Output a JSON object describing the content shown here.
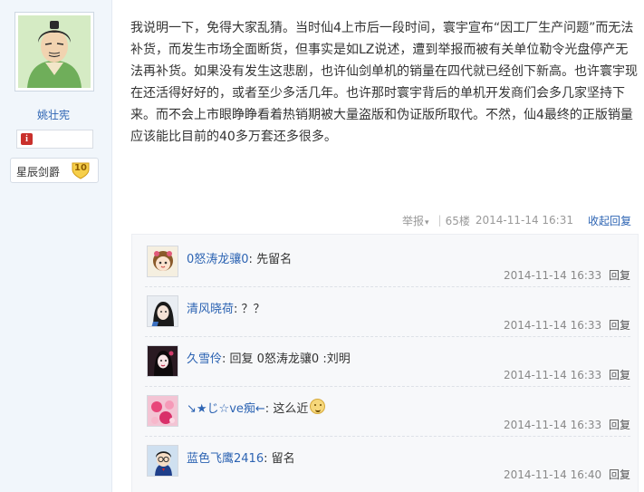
{
  "author": {
    "name": "姚壮宪",
    "avatar_icon": "swordsman-avatar-icon",
    "info_icon": "warning-icon",
    "level_name": "星辰剑爵",
    "level_number": "10"
  },
  "post": {
    "content": "我说明一下，免得大家乱猜。当时仙4上市后一段时间，寰宇宣布“因工厂生产问题”而无法补货，而发生市场全面断货，但事实是如LZ说述，遭到举报而被有关单位勒令光盘停产无法再补货。如果没有发生这悲剧，也许仙剑单机的销量在四代就已经创下新高。也许寰宇现在还活得好好的，或者至少多活几年。也许那时寰宇背后的单机开发商们会多几家坚持下来。而不会上市眼睁睁看着热销期被大量盗版和伪证版所取代。不然，仙4最终的正版销量应该能比目前的40多万套还多很多。",
    "report_label": "举报",
    "floor": "65楼",
    "time": "2014-11-14 16:31",
    "collapse_label": "收起回复"
  },
  "replies": [
    {
      "user": "0怒涛龙骧0",
      "text": "先留名",
      "time": "2014-11-14 16:33",
      "reply_label": "回复",
      "avatar_icon": "girl-avatar-icon"
    },
    {
      "user": "清风晓荷",
      "text": "？？",
      "time": "2014-11-14 16:33",
      "reply_label": "回复",
      "avatar_icon": "girl-avatar-icon"
    },
    {
      "user": "久雪伶",
      "text": "回复 0怒涛龙骧0 :刘明",
      "time": "2014-11-14 16:33",
      "reply_label": "回复",
      "avatar_icon": "girl-avatar-icon"
    },
    {
      "user": "↘★じ☆ve痴←",
      "text": "这么近",
      "time": "2014-11-14 16:33",
      "reply_label": "回复",
      "avatar_icon": "flowers-avatar-icon"
    },
    {
      "user": "蓝色飞鹰2416",
      "text": "留名",
      "time": "2014-11-14 16:40",
      "reply_label": "回复",
      "avatar_icon": "detective-avatar-icon"
    }
  ],
  "colors": {
    "link": "#2d64b3",
    "sidebar_bg": "#f1f6fb",
    "reply_bg": "#f7f8fa"
  }
}
